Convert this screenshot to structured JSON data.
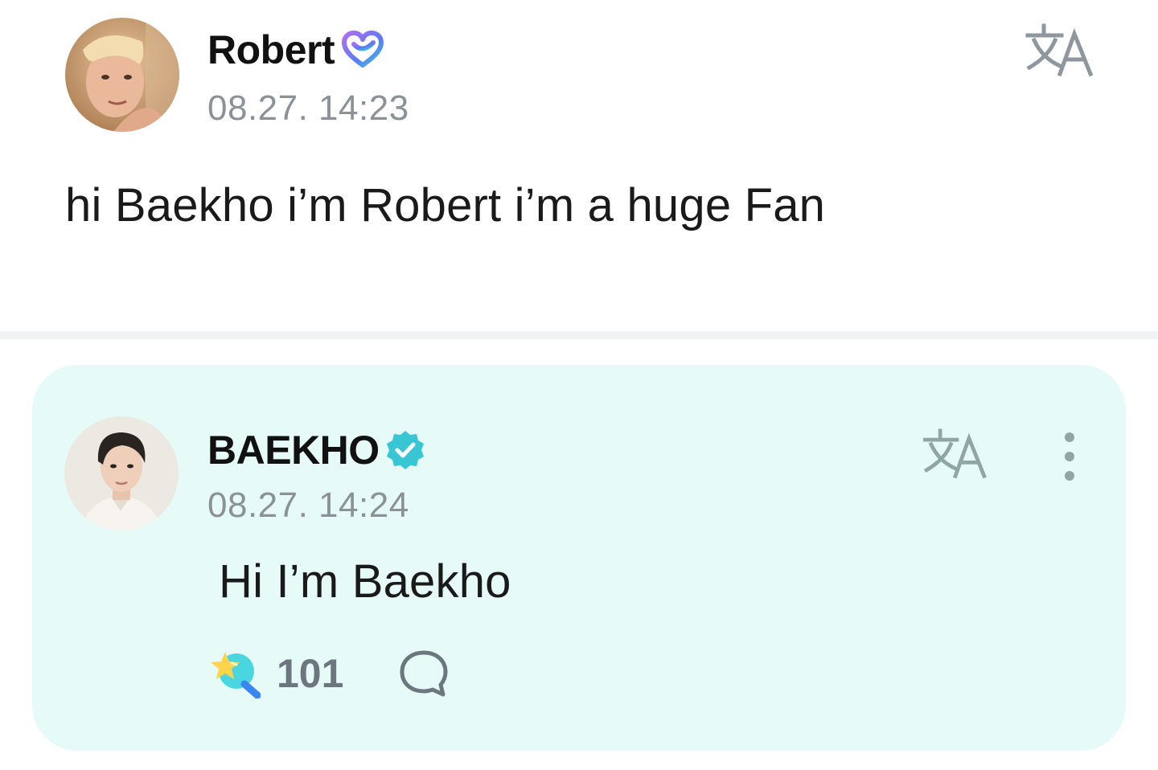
{
  "post": {
    "author": {
      "name": "Robert",
      "badge_icon": "heart-badge-icon",
      "avatar_icon": "user-avatar"
    },
    "timestamp": "08.27. 14:23",
    "body": "hi Baekho i’m Robert i’m a huge Fan",
    "translate_icon": "translate-icon"
  },
  "reply": {
    "author": {
      "name": "BAEKHO",
      "badge_icon": "verified-badge-icon",
      "avatar_icon": "artist-avatar"
    },
    "timestamp": "08.27. 14:24",
    "body": "Hi I’m Baekho",
    "translate_icon": "translate-icon",
    "more_icon": "more-vertical-icon",
    "reactions": {
      "like_icon": "star-wand-icon",
      "like_count": "101",
      "comment_icon": "comment-bubble-icon"
    }
  },
  "colors": {
    "reply_background": "#e6fbf7",
    "timestamp": "#8a9298",
    "verified_badge": "#39c6d4",
    "divider": "#f2f3f4"
  }
}
